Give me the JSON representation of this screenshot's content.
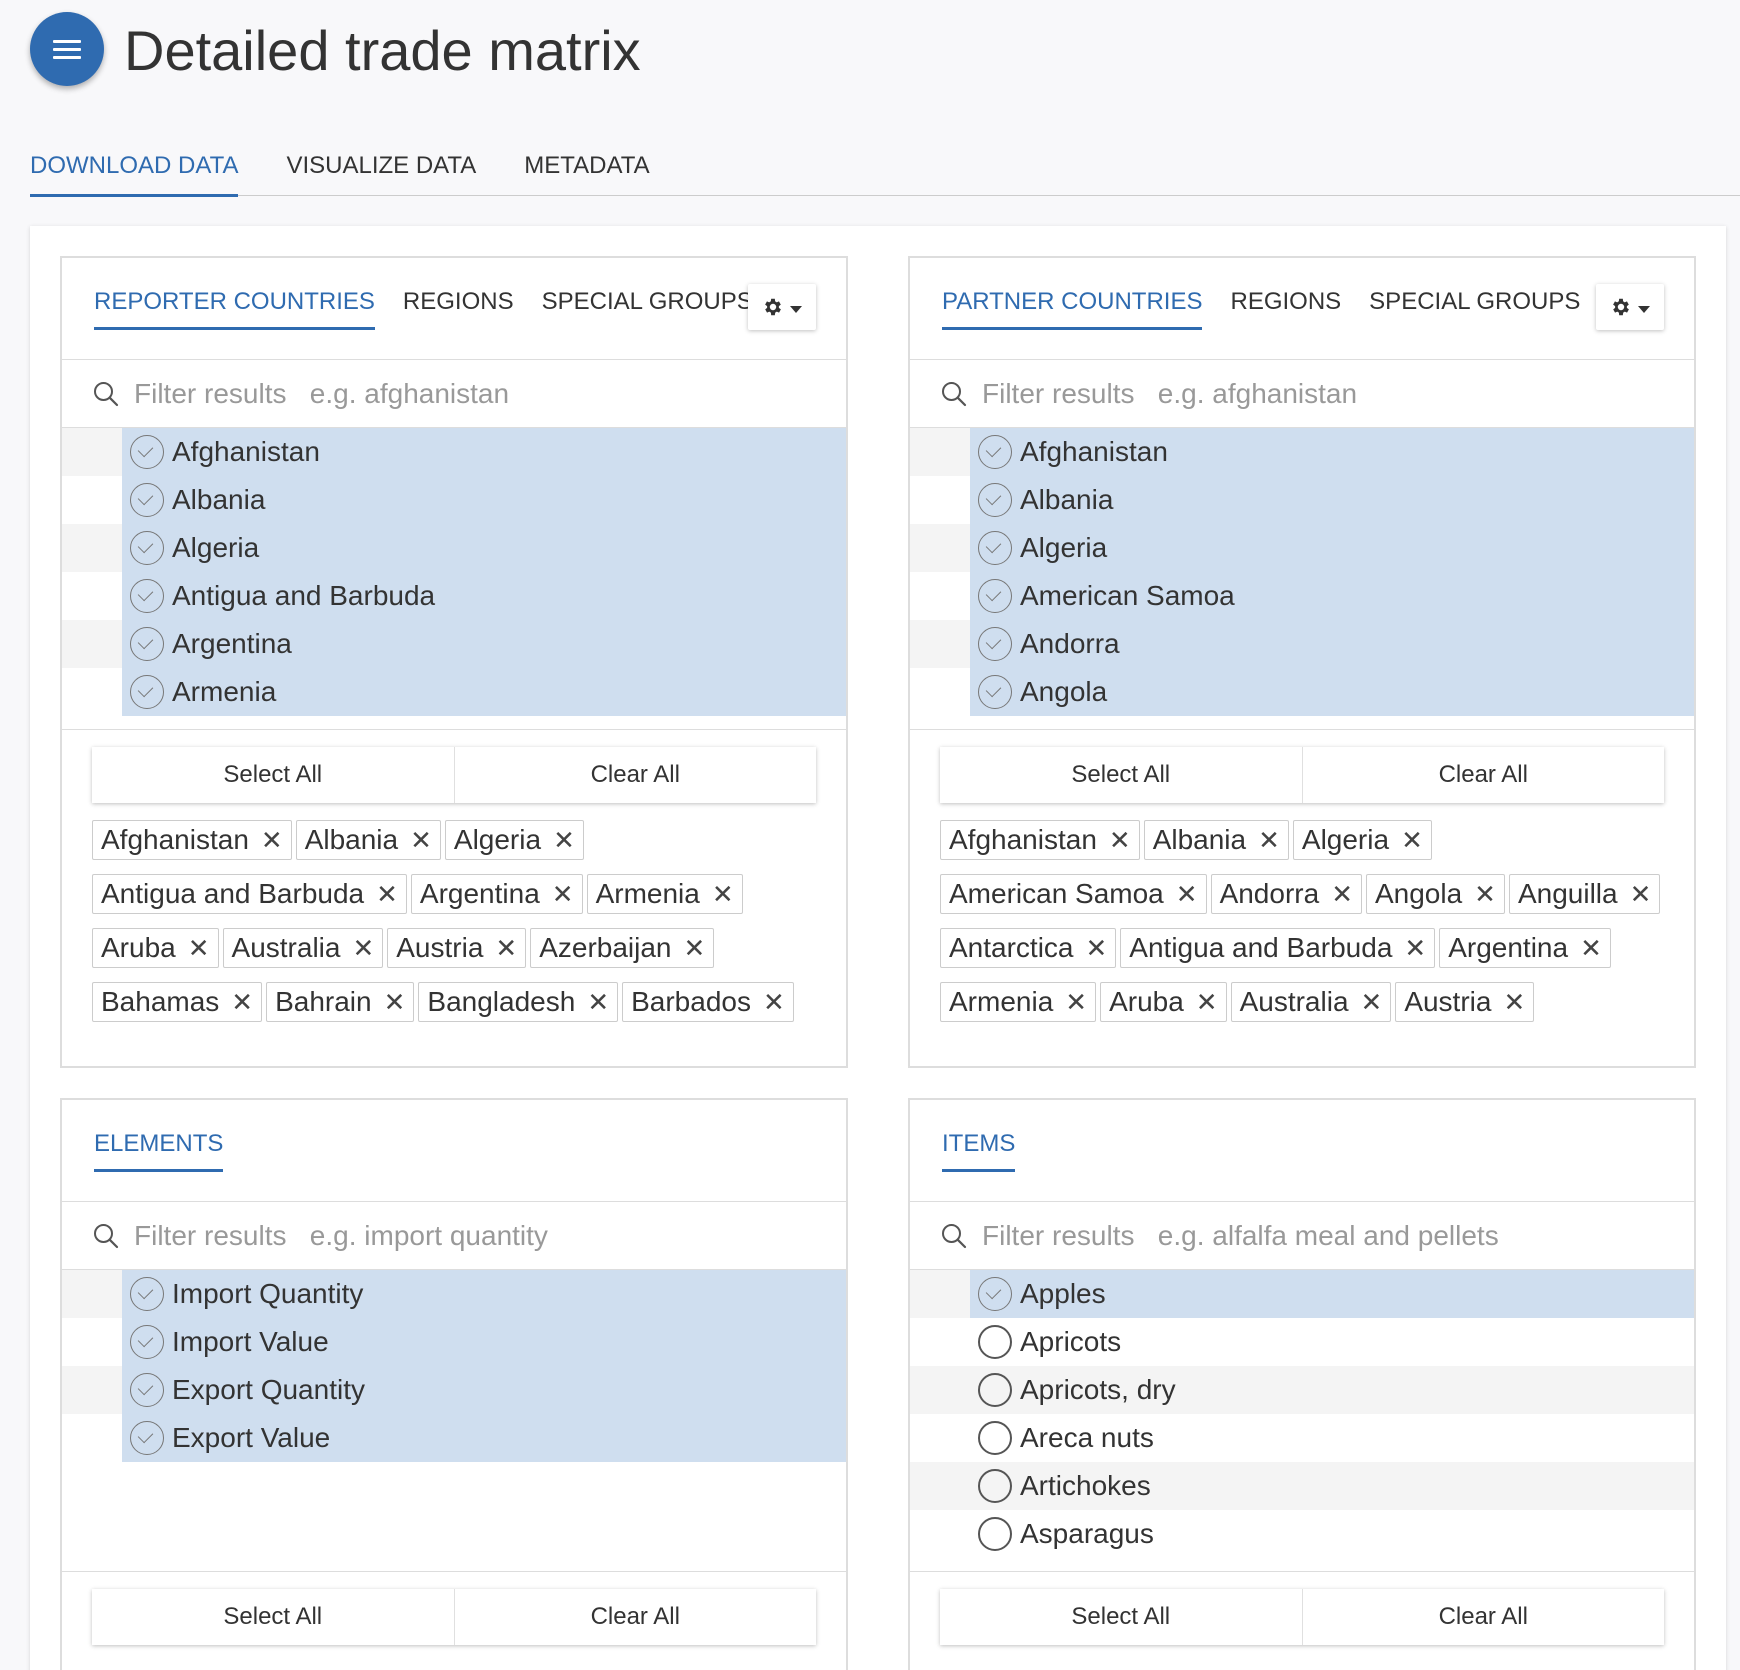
{
  "title": "Detailed trade matrix",
  "main_tabs": [
    {
      "label": "DOWNLOAD DATA",
      "active": true
    },
    {
      "label": "VISUALIZE DATA",
      "active": false
    },
    {
      "label": "METADATA",
      "active": false
    }
  ],
  "select_all_label": "Select All",
  "clear_all_label": "Clear All",
  "reporter": {
    "tabs": [
      "REPORTER COUNTRIES",
      "REGIONS",
      "SPECIAL GROUPS"
    ],
    "filter_placeholder": "Filter results   e.g. afghanistan",
    "items": [
      "Afghanistan",
      "Albania",
      "Algeria",
      "Antigua and Barbuda",
      "Argentina",
      "Armenia"
    ],
    "chips": [
      "Afghanistan",
      "Albania",
      "Algeria",
      "Antigua and Barbuda",
      "Argentina",
      "Armenia",
      "Aruba",
      "Australia",
      "Austria",
      "Azerbaijan",
      "Bahamas",
      "Bahrain",
      "Bangladesh",
      "Barbados"
    ]
  },
  "partner": {
    "tabs": [
      "PARTNER COUNTRIES",
      "REGIONS",
      "SPECIAL GROUPS"
    ],
    "filter_placeholder": "Filter results   e.g. afghanistan",
    "items": [
      "Afghanistan",
      "Albania",
      "Algeria",
      "American Samoa",
      "Andorra",
      "Angola"
    ],
    "chips": [
      "Afghanistan",
      "Albania",
      "Algeria",
      "American Samoa",
      "Andorra",
      "Angola",
      "Anguilla",
      "Antarctica",
      "Antigua and Barbuda",
      "Argentina",
      "Armenia",
      "Aruba",
      "Australia",
      "Austria"
    ]
  },
  "elements": {
    "tabs": [
      "ELEMENTS"
    ],
    "filter_placeholder": "Filter results   e.g. import quantity",
    "items": [
      "Import Quantity",
      "Import Value",
      "Export Quantity",
      "Export Value"
    ]
  },
  "items_panel": {
    "tabs": [
      "ITEMS"
    ],
    "filter_placeholder": "Filter results   e.g. alfalfa meal and pellets",
    "items": [
      "Apples",
      "Apricots",
      "Apricots, dry",
      "Areca nuts",
      "Artichokes",
      "Asparagus"
    ],
    "selected": [
      "Apples"
    ]
  }
}
